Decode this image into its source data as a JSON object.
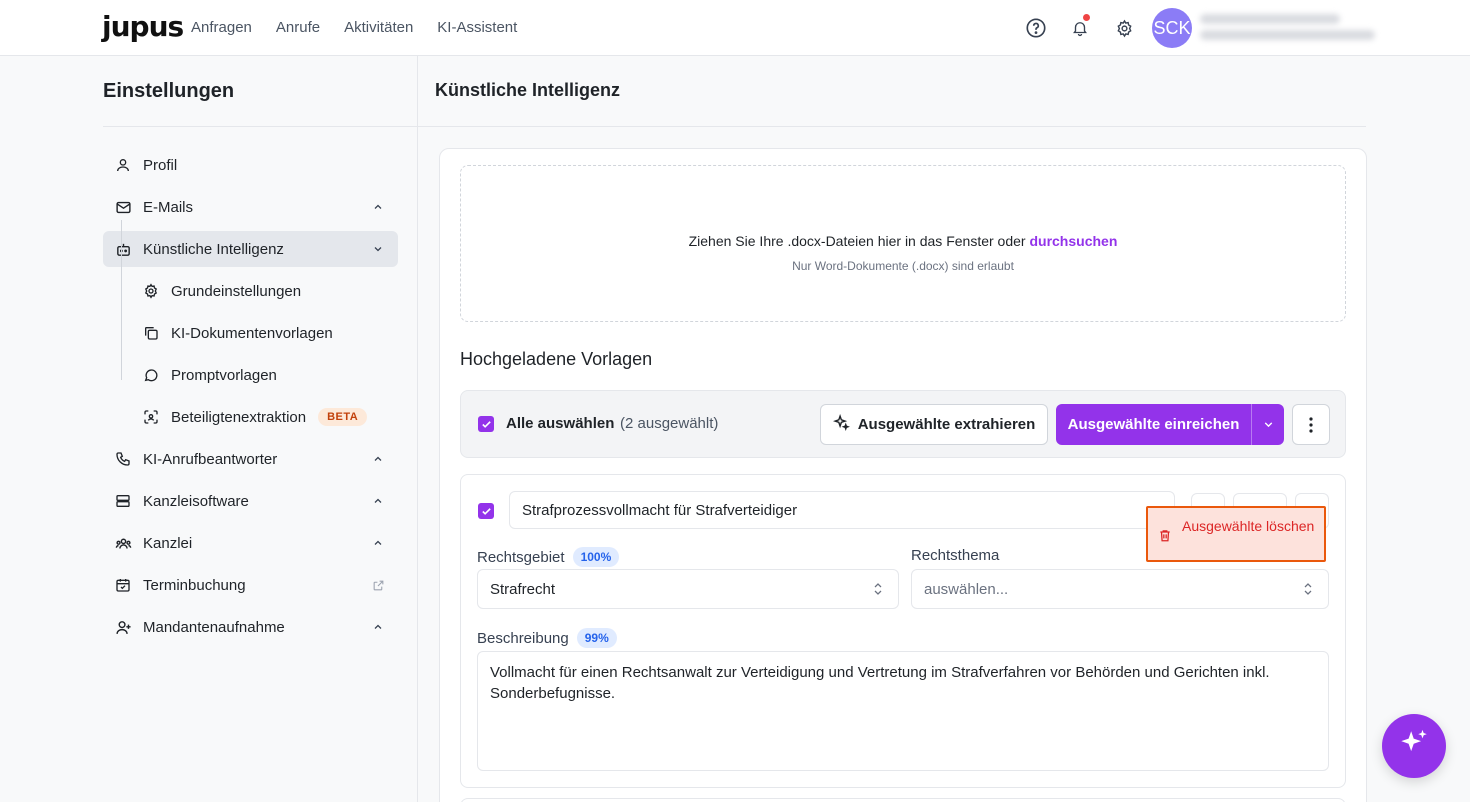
{
  "app": {
    "logo": "jupus",
    "nav": [
      "Anfragen",
      "Anrufe",
      "Aktivitäten",
      "KI-Assistent"
    ],
    "avatar_initials": "SCK",
    "accent_color": "#9333ea"
  },
  "sidebar": {
    "title": "Einstellungen",
    "items": [
      {
        "label": "Profil",
        "icon": "user-icon"
      },
      {
        "label": "E-Mails",
        "icon": "mail-icon"
      },
      {
        "label": "Künstliche Intelligenz",
        "icon": "robot-icon"
      },
      {
        "label": "KI-Anrufbeantworter",
        "icon": "phone-icon"
      },
      {
        "label": "Kanzleisoftware",
        "icon": "server-icon"
      },
      {
        "label": "Kanzlei",
        "icon": "team-icon"
      },
      {
        "label": "Terminbuchung",
        "icon": "calendar-check-icon"
      },
      {
        "label": "Mandantenaufnahme",
        "icon": "user-plus-icon"
      }
    ],
    "subitems": [
      {
        "label": "Grundeinstellungen",
        "icon": "gear-icon"
      },
      {
        "label": "KI-Dokumentenvorlagen",
        "icon": "copy-icon"
      },
      {
        "label": "Promptvorlagen",
        "icon": "chat-bubble-icon"
      },
      {
        "label": "Beteiligtenextraktion",
        "icon": "scan-face-icon"
      }
    ],
    "beta_label": "BETA"
  },
  "main": {
    "title": "Künstliche Intelligenz",
    "dropzone": {
      "text": "Ziehen Sie Ihre .docx-Dateien hier in das Fenster oder ",
      "link": "durchsuchen",
      "hint": "Nur Word-Dokumente (.docx) sind erlaubt"
    },
    "section_title": "Hochgeladene Vorlagen",
    "toolbar": {
      "select_all": "Alle auswählen",
      "selected_count": "(2 ausgewählt)",
      "extract_button": "Ausgewählte extrahieren",
      "submit_button": "Ausgewählte einreichen"
    },
    "template": {
      "name": "Strafprozessvollmacht für Strafverteidiger",
      "rechtsgebiet_label": "Rechtsgebiet",
      "rechtsgebiet_confidence": "100%",
      "rechtsgebiet_value": "Strafrecht",
      "rechtsthema_label": "Rechtsthema",
      "rechtsthema_placeholder": "auswählen...",
      "beschreibung_label": "Beschreibung",
      "beschreibung_confidence": "99%",
      "beschreibung_value": "Vollmacht für einen Rechtsanwalt zur Verteidigung und Vertretung im Strafverfahren vor Behörden und Gerichten inkl. Sonderbefugnisse."
    },
    "popover": {
      "delete_label": "Ausgewählte löschen"
    }
  }
}
